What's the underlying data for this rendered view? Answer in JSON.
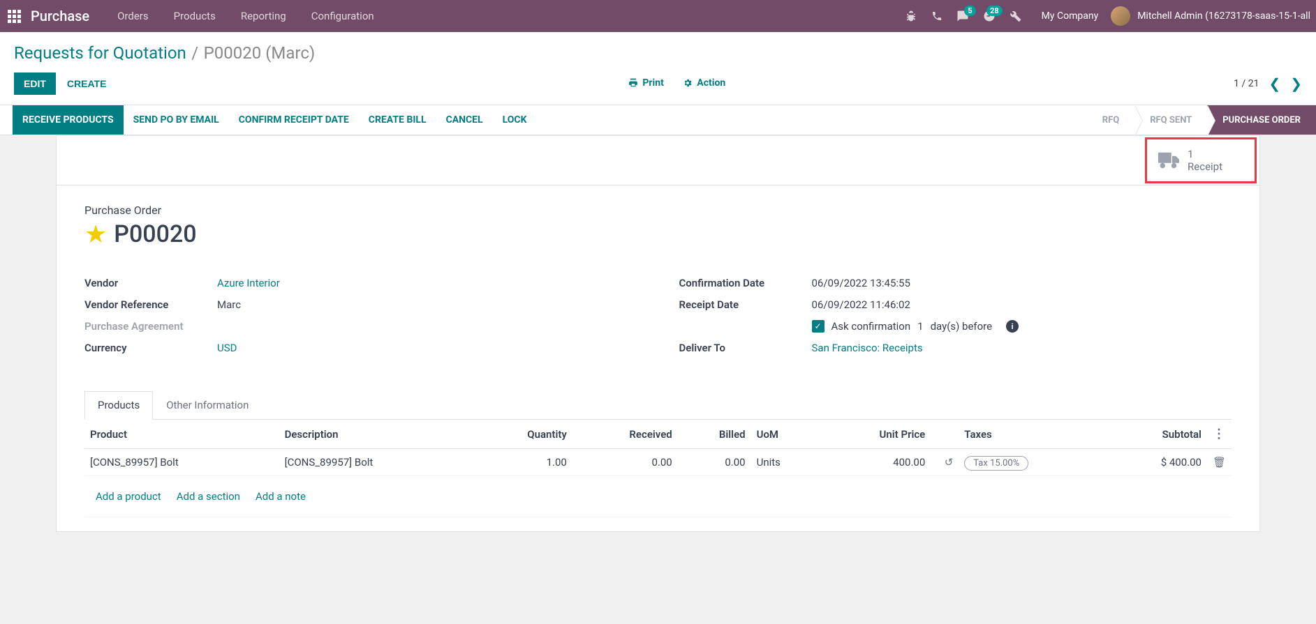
{
  "navbar": {
    "brand": "Purchase",
    "menu": [
      "Orders",
      "Products",
      "Reporting",
      "Configuration"
    ],
    "msg_badge": "5",
    "act_badge": "28",
    "company": "My Company",
    "user": "Mitchell Admin (16273178-saas-15-1-all"
  },
  "breadcrumb": {
    "link": "Requests for Quotation",
    "current": "P00020 (Marc)"
  },
  "toolbar": {
    "edit": "EDIT",
    "create": "CREATE",
    "print": "Print",
    "action": "Action",
    "pager": "1 / 21"
  },
  "statusbar": {
    "buttons": [
      "RECEIVE PRODUCTS",
      "SEND PO BY EMAIL",
      "CONFIRM RECEIPT DATE",
      "CREATE BILL",
      "CANCEL",
      "LOCK"
    ],
    "steps": [
      "RFQ",
      "RFQ SENT",
      "PURCHASE ORDER"
    ]
  },
  "statbox": {
    "count": "1",
    "label": "Receipt"
  },
  "record": {
    "type_label": "Purchase Order",
    "name": "P00020",
    "left": {
      "vendor_label": "Vendor",
      "vendor": "Azure Interior",
      "vref_label": "Vendor Reference",
      "vref": "Marc",
      "pa_label": "Purchase Agreement",
      "currency_label": "Currency",
      "currency": "USD"
    },
    "right": {
      "conf_label": "Confirmation Date",
      "conf": "06/09/2022 13:45:55",
      "rec_label": "Receipt Date",
      "rec": "06/09/2022 11:46:02",
      "ask_pre": "Ask confirmation",
      "ask_days": "1",
      "ask_post": "day(s) before",
      "deliver_label": "Deliver To",
      "deliver": "San Francisco: Receipts"
    }
  },
  "tabs": [
    "Products",
    "Other Information"
  ],
  "table": {
    "headers": {
      "product": "Product",
      "desc": "Description",
      "qty": "Quantity",
      "received": "Received",
      "billed": "Billed",
      "uom": "UoM",
      "price": "Unit Price",
      "taxes": "Taxes",
      "subtotal": "Subtotal"
    },
    "rows": [
      {
        "product": "[CONS_89957] Bolt",
        "desc": "[CONS_89957] Bolt",
        "qty": "1.00",
        "received": "0.00",
        "billed": "0.00",
        "uom": "Units",
        "price": "400.00",
        "tax": "Tax 15.00%",
        "subtotal": "$ 400.00"
      }
    ],
    "add": {
      "product": "Add a product",
      "section": "Add a section",
      "note": "Add a note"
    }
  }
}
